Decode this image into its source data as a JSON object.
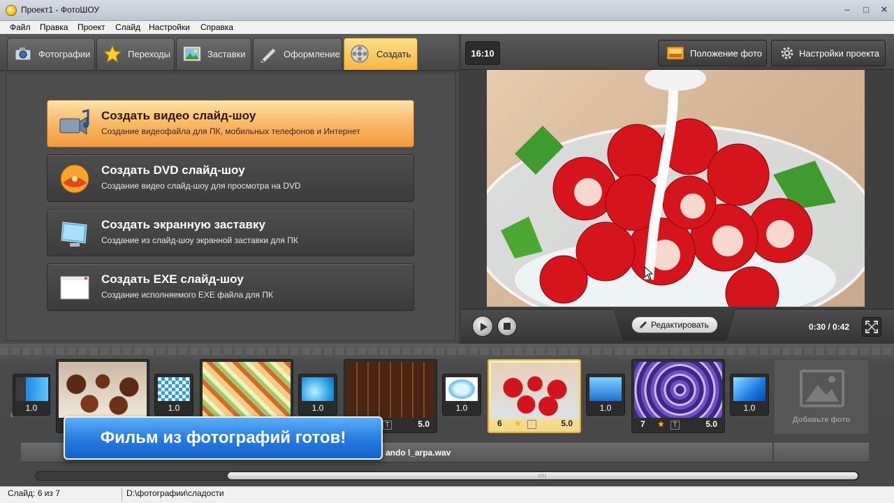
{
  "window": {
    "title": "Проект1 - ФотоШОУ",
    "controls": [
      "–",
      "□",
      "✕"
    ]
  },
  "menu": [
    "Файл",
    "Правка",
    "Проект",
    "Слайд",
    "Настройки",
    "Справка"
  ],
  "tabs": [
    {
      "label": "Фотографии",
      "icon": "camera-icon"
    },
    {
      "label": "Переходы",
      "icon": "star-icon"
    },
    {
      "label": "Заставки",
      "icon": "landscape-icon"
    },
    {
      "label": "Оформление",
      "icon": "brush-icon"
    },
    {
      "label": "Создать",
      "icon": "film-reel-icon",
      "active": true
    }
  ],
  "create_options": [
    {
      "title": "Создать видео слайд-шоу",
      "subtitle": "Создание видеофайла для ПК, мобильных телефонов и Интернет",
      "icon": "video-music-icon",
      "active": true
    },
    {
      "title": "Создать DVD слайд-шоу",
      "subtitle": "Создание видео слайд-шоу для просмотра на DVD",
      "icon": "dvd-disc-icon"
    },
    {
      "title": "Создать экранную заставку",
      "subtitle": "Создание из слайд-шоу экранной заставки для ПК",
      "icon": "monitor-icon"
    },
    {
      "title": "Создать EXE слайд-шоу",
      "subtitle": "Создание исполняемого EXE файла для ПК",
      "icon": "exe-window-icon"
    }
  ],
  "preview": {
    "aspect_ratio": "16:10",
    "photo_position_label": "Положение фото",
    "project_settings_label": "Настройки проекта",
    "edit_label": "Редактировать",
    "time": "0:30 / 0:42"
  },
  "timeline": {
    "transitions": [
      "1.0",
      "1.0",
      "1.0",
      "1.0",
      "1.0",
      "1.0"
    ],
    "slides": [
      {
        "num": "",
        "duration": "",
        "star": false
      },
      {
        "num": "",
        "duration": "",
        "star": false
      },
      {
        "num": "",
        "duration": "5.0",
        "star": false
      },
      {
        "num": "6",
        "duration": "5.0",
        "star": true,
        "selected": true
      },
      {
        "num": "7",
        "duration": "5.0",
        "star": true
      }
    ],
    "add_photo_label": "Добавьте фото",
    "audio_file": "ando l_arpa.wav"
  },
  "banner": "Фильм из фотографий готов!",
  "status": {
    "slide": "Слайд: 6 из 7",
    "path": "D:\\фотографии\\сладости"
  },
  "colors": {
    "accent": "#f5b645",
    "banner": "#2a7ee0",
    "panel": "#4b4b4b"
  }
}
